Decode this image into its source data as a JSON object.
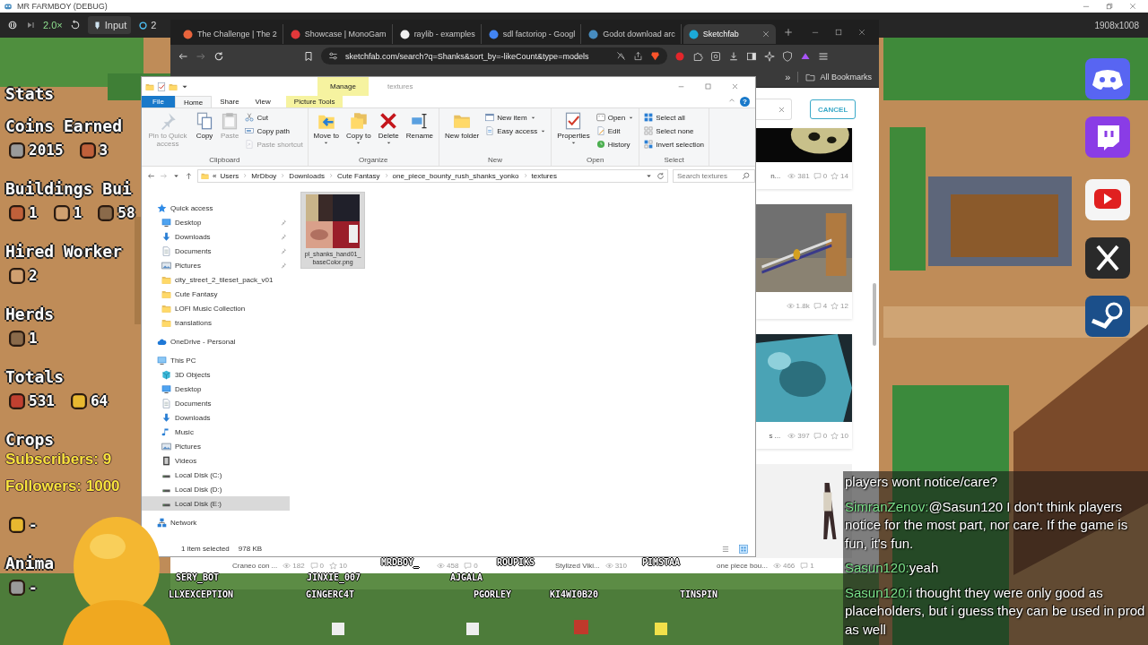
{
  "game_window": {
    "title": "MR FARMBOY (DEBUG)",
    "speed": "2.0×",
    "input_button": "Input",
    "counter": "2",
    "resolution": "1908x1008"
  },
  "hud": [
    {
      "heading": "Stats"
    },
    {
      "heading": "Coins Earned",
      "values": [
        "2015",
        "3"
      ]
    },
    {
      "heading": "Buildings Bui",
      "values": [
        "1",
        "1",
        "58"
      ]
    },
    {
      "heading": "Hired Worker",
      "values": [
        "2"
      ]
    },
    {
      "heading": "Herds",
      "values": [
        "1"
      ]
    },
    {
      "heading": "Totals",
      "values": [
        "531",
        "64"
      ]
    },
    {
      "heading": "Crops",
      "values": [
        "-"
      ]
    },
    {
      "heading": "Anima",
      "values": [
        "-"
      ]
    }
  ],
  "overlay": {
    "subscribers": "Subscribers: 9",
    "followers": "Followers: 1000"
  },
  "browser": {
    "tabs": [
      {
        "label": "The Challenge | The 2",
        "selected": false
      },
      {
        "label": "Showcase | MonoGam",
        "selected": false
      },
      {
        "label": "raylib - examples",
        "selected": false
      },
      {
        "label": "sdl factoriop - Googl",
        "selected": false
      },
      {
        "label": "Godot download arc",
        "selected": false
      },
      {
        "label": "Sketchfab",
        "selected": true
      }
    ],
    "url": "sketchfab.com/search?q=Shanks&sort_by=-likeCount&type=models",
    "bookmarks_overflow": "»",
    "all_bookmarks": "All Bookmarks",
    "page": {
      "cancel": "CANCEL",
      "side_cards": [
        {
          "title": "n...",
          "views": "381",
          "comments": "0",
          "likes": "14"
        },
        {
          "views": "1.8k",
          "comments": "4",
          "likes": "12"
        },
        {
          "title": "s ...",
          "views": "397",
          "comments": "0",
          "likes": "10"
        }
      ],
      "bottom_cards": [
        {
          "title": "Craneo con ...",
          "views": "182",
          "comments": "0",
          "likes": "10"
        },
        {
          "views": "458",
          "comments": "0"
        },
        {
          "title": "Stylized Viki...",
          "views": "310"
        },
        {
          "title": "one piece bou...",
          "views": "466",
          "comments": "1"
        }
      ]
    }
  },
  "explorer": {
    "title": "textures",
    "contextual_header": "Manage",
    "help": "?",
    "tabs": [
      {
        "label": "File",
        "kind": "file",
        "selected": false
      },
      {
        "label": "Home",
        "kind": "normal",
        "selected": true
      },
      {
        "label": "Share",
        "kind": "normal",
        "selected": false
      },
      {
        "label": "View",
        "kind": "normal",
        "selected": false
      },
      {
        "label": "Picture Tools",
        "kind": "contextual",
        "selected": false
      }
    ],
    "ribbon": [
      {
        "label": "Clipboard",
        "items": [
          {
            "label": "Pin to Quick access",
            "kind": "large",
            "disabled": true
          },
          {
            "label": "Copy",
            "kind": "large",
            "disabled": false
          },
          {
            "label": "Paste",
            "kind": "large",
            "disabled": true
          },
          {
            "label": "Cut",
            "kind": "small",
            "disabled": false
          },
          {
            "label": "Copy path",
            "kind": "small",
            "disabled": false
          },
          {
            "label": "Paste shortcut",
            "kind": "small",
            "disabled": true
          }
        ]
      },
      {
        "label": "Organize",
        "items": [
          {
            "label": "Move to",
            "kind": "large",
            "disabled": false,
            "dropdown": true
          },
          {
            "label": "Copy to",
            "kind": "large",
            "disabled": false,
            "dropdown": true
          },
          {
            "label": "Delete",
            "kind": "large",
            "disabled": false,
            "dropdown": true
          },
          {
            "label": "Rename",
            "kind": "large",
            "disabled": false
          }
        ]
      },
      {
        "label": "New",
        "items": [
          {
            "label": "New folder",
            "kind": "large",
            "disabled": false
          },
          {
            "label": "New item",
            "kind": "small",
            "disabled": false,
            "dropdown": true
          },
          {
            "label": "Easy access",
            "kind": "small",
            "disabled": false,
            "dropdown": true
          }
        ]
      },
      {
        "label": "Open",
        "items": [
          {
            "label": "Properties",
            "kind": "large",
            "disabled": false,
            "dropdown": true
          },
          {
            "label": "Open",
            "kind": "small",
            "disabled": false,
            "dropdown": true
          },
          {
            "label": "Edit",
            "kind": "small",
            "disabled": false
          },
          {
            "label": "History",
            "kind": "small",
            "disabled": false
          }
        ]
      },
      {
        "label": "Select",
        "items": [
          {
            "label": "Select all",
            "kind": "small",
            "disabled": false
          },
          {
            "label": "Select none",
            "kind": "small",
            "disabled": false
          },
          {
            "label": "Invert selection",
            "kind": "small",
            "disabled": false
          }
        ]
      }
    ],
    "path_overflow": "«",
    "path": [
      "Users",
      "MrDboy",
      "Downloads",
      "Cute Fantasy",
      "one_piece_bounty_rush_shanks_yonko",
      "textures"
    ],
    "search": {
      "placeholder": "Search textures"
    },
    "nav": [
      {
        "label": "Quick access",
        "kind": "star",
        "selected": false,
        "children": [
          {
            "label": "Desktop",
            "kind": "desktop",
            "selected": false,
            "pinned": true
          },
          {
            "label": "Downloads",
            "kind": "downloads",
            "selected": false,
            "pinned": true
          },
          {
            "label": "Documents",
            "kind": "documents",
            "selected": false,
            "pinned": true
          },
          {
            "label": "Pictures",
            "kind": "pictures",
            "selected": false,
            "pinned": true
          },
          {
            "label": "city_street_2_tileset_pack_v01",
            "kind": "folder",
            "selected": false,
            "pinned": false
          },
          {
            "label": "Cute Fantasy",
            "kind": "folder",
            "selected": false,
            "pinned": false
          },
          {
            "label": "LOFI Music Collection",
            "kind": "folder",
            "selected": false,
            "pinned": false
          },
          {
            "label": "translations",
            "kind": "folder",
            "selected": false,
            "pinned": false
          }
        ]
      },
      {
        "label": "OneDrive - Personal",
        "kind": "cloud",
        "selected": false
      },
      {
        "label": "This PC",
        "kind": "pc",
        "selected": false,
        "children": [
          {
            "label": "3D Objects",
            "kind": "objects",
            "selected": false
          },
          {
            "label": "Desktop",
            "kind": "desktop",
            "selected": false
          },
          {
            "label": "Documents",
            "kind": "documents",
            "selected": false
          },
          {
            "label": "Downloads",
            "kind": "downloads",
            "selected": false
          },
          {
            "label": "Music",
            "kind": "music",
            "selected": false
          },
          {
            "label": "Pictures",
            "kind": "pictures",
            "selected": false
          },
          {
            "label": "Videos",
            "kind": "videos",
            "selected": false
          },
          {
            "label": "Local Disk (C:)",
            "kind": "disk",
            "selected": false
          },
          {
            "label": "Local Disk (D:)",
            "kind": "disk",
            "selected": false
          },
          {
            "label": "Local Disk (E:)",
            "kind": "disk",
            "selected": true
          }
        ]
      },
      {
        "label": "Network",
        "kind": "network",
        "selected": false
      }
    ],
    "files": [
      {
        "name": "pl_shanks_hand01_baseColor.png",
        "selected": true,
        "kind": "picture"
      }
    ],
    "status": {
      "count": "1 item selected",
      "size": "978 KB"
    }
  },
  "viewers": [
    "MRDBOY_",
    "ROUPIKS",
    "PIMSTAA",
    "SERY_BOT",
    "JINXIE_007",
    "AJGALA",
    "LLXEXCEPTION",
    "GINGERC4T",
    "PGORLEY",
    "KI4WI0B20",
    "TINSPIN"
  ],
  "chat": [
    {
      "text": "players wont notice/care?"
    },
    {
      "user": "SimranZenov:",
      "text": "@Sasun120 I don't think players notice for the most part, nor care. If the game is fun, it's fun."
    },
    {
      "user": "Sasun120:",
      "text": "yeah"
    },
    {
      "user": "Sasun120:",
      "text": "i thought they were only good as placeholders, but i guess they can be used in prod as well"
    }
  ]
}
